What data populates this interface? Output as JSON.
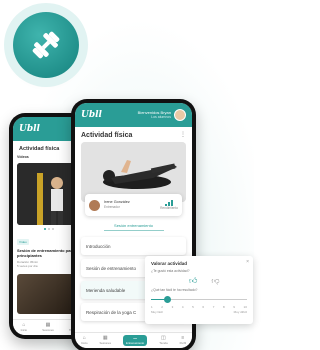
{
  "colors": {
    "brand": "#2a9d96",
    "brand_light": "#e1f3f2"
  },
  "app_icon": {
    "icon": "dumbbell-icon"
  },
  "front_phone": {
    "logo": "Ubll",
    "user_name": "Bienvenidos Bryan",
    "user_sub": "Los alumnos",
    "page_title": "Actividad física",
    "trainer": {
      "name": "Irene González",
      "role": "Entrenador",
      "perf_label": "Rendimiento"
    },
    "tab_label": "Sesión entrenamiento",
    "list": [
      "Introducción",
      "Sesión de entrenamiento",
      "Merienda saludable",
      "Respiración de la yoga C"
    ],
    "nav": [
      "Inicio",
      "Sesiones",
      "Entrenamiento",
      "Tienda",
      "Perfil"
    ]
  },
  "back_phone": {
    "logo": "Ubll",
    "page_title": "Actividad física",
    "section": "Vídeos",
    "tag": "Vídeo",
    "video_title": "Sesión de entrenamiento para principiantes",
    "video_meta": [
      "Duración 45min",
      "5 veces por día"
    ],
    "nav": [
      "Inicio",
      "Sesiones",
      "Tienda"
    ]
  },
  "rating_card": {
    "title": "Valorar actividad",
    "question": "¿Te gustó esta actividad?",
    "slider_question": "¿Qué tan fácil te ha resultado?",
    "slider_value": 0.15,
    "slider_ticks": [
      "1",
      "2",
      "3",
      "4",
      "5",
      "6",
      "7",
      "8",
      "9",
      "10"
    ],
    "slider_left": "Muy fácil",
    "slider_right": "Muy difícil"
  }
}
